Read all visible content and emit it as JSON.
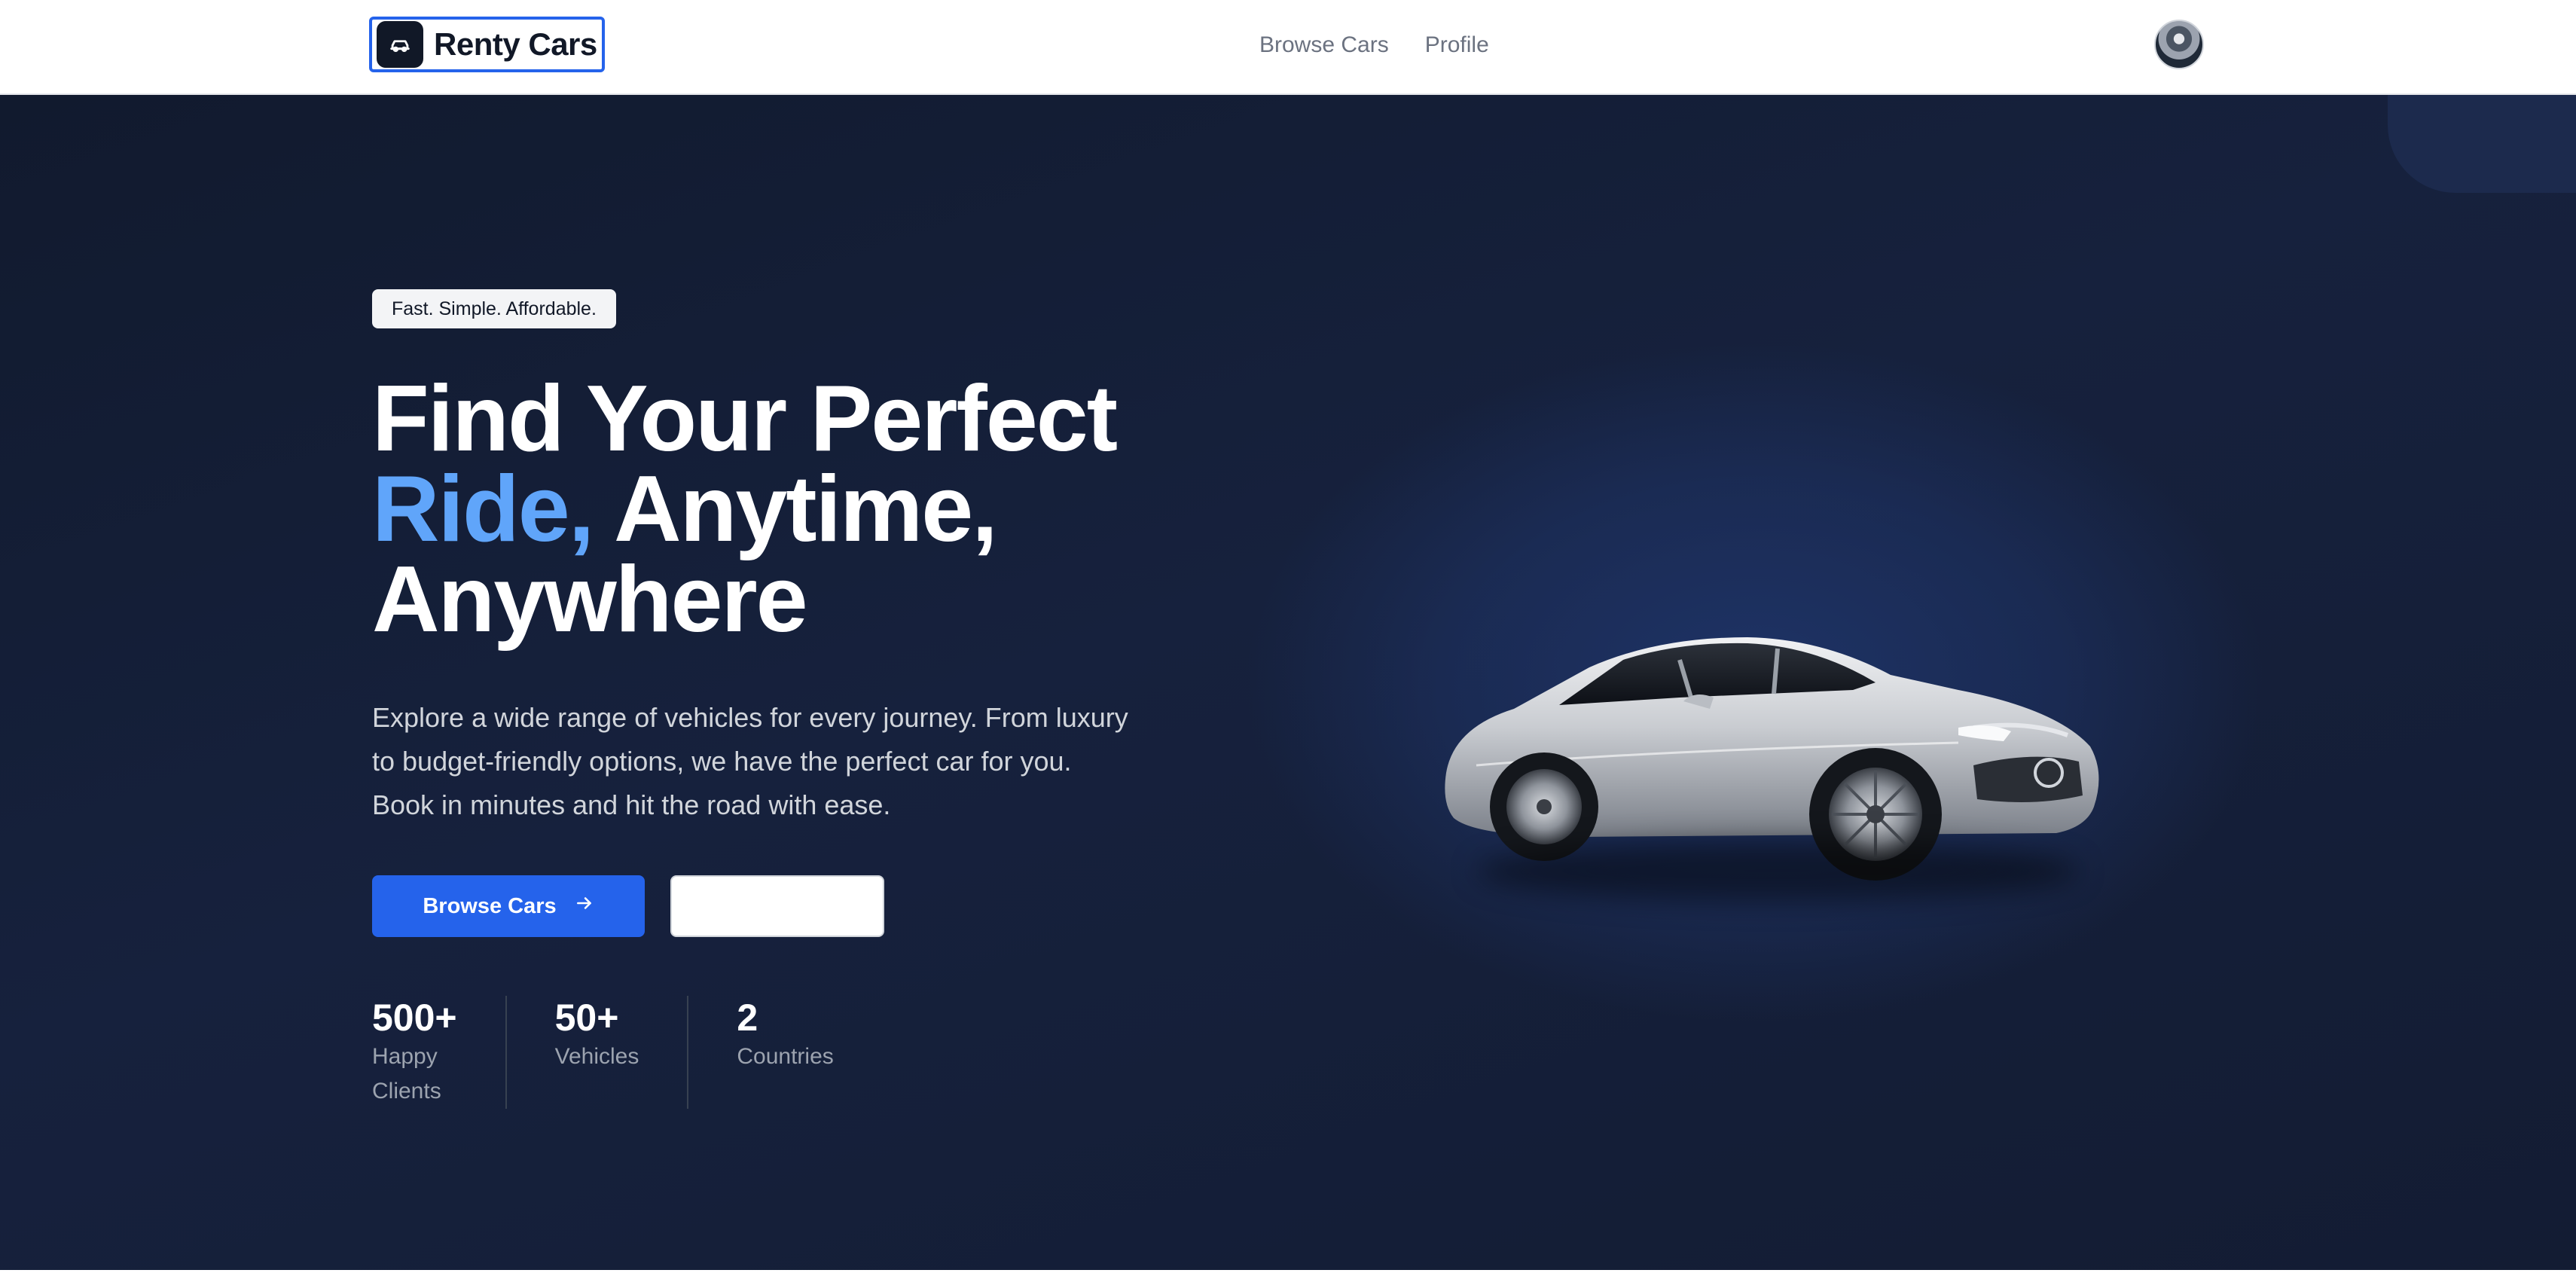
{
  "nav": {
    "brand_name": "Renty Cars",
    "brand_icon": "car-icon",
    "links": [
      {
        "label": "Browse Cars"
      },
      {
        "label": "Profile"
      }
    ],
    "avatar_icon": "user-avatar"
  },
  "hero": {
    "tagline": "Fast. Simple. Affordable.",
    "headline_line1": "Find Your Perfect",
    "headline_accent": "Ride,",
    "headline_line2_rest": " Anytime,",
    "headline_line3": "Anywhere",
    "description": "Explore a wide range of vehicles for every journey. From luxury to budget-friendly options, we have the perfect car for you. Book in minutes and hit the road with ease.",
    "primary_button": {
      "label": "Browse Cars",
      "icon": "arrow-right-icon"
    },
    "secondary_button": {
      "label": ""
    },
    "image": "silver-sedan-car"
  },
  "stats": [
    {
      "value": "500+",
      "label": "Happy Clients"
    },
    {
      "value": "50+",
      "label": "Vehicles"
    },
    {
      "value": "2",
      "label": "Countries"
    }
  ],
  "colors": {
    "accent": "#60a5fa",
    "primary_button": "#2563eb",
    "hero_background": "#16213d"
  }
}
